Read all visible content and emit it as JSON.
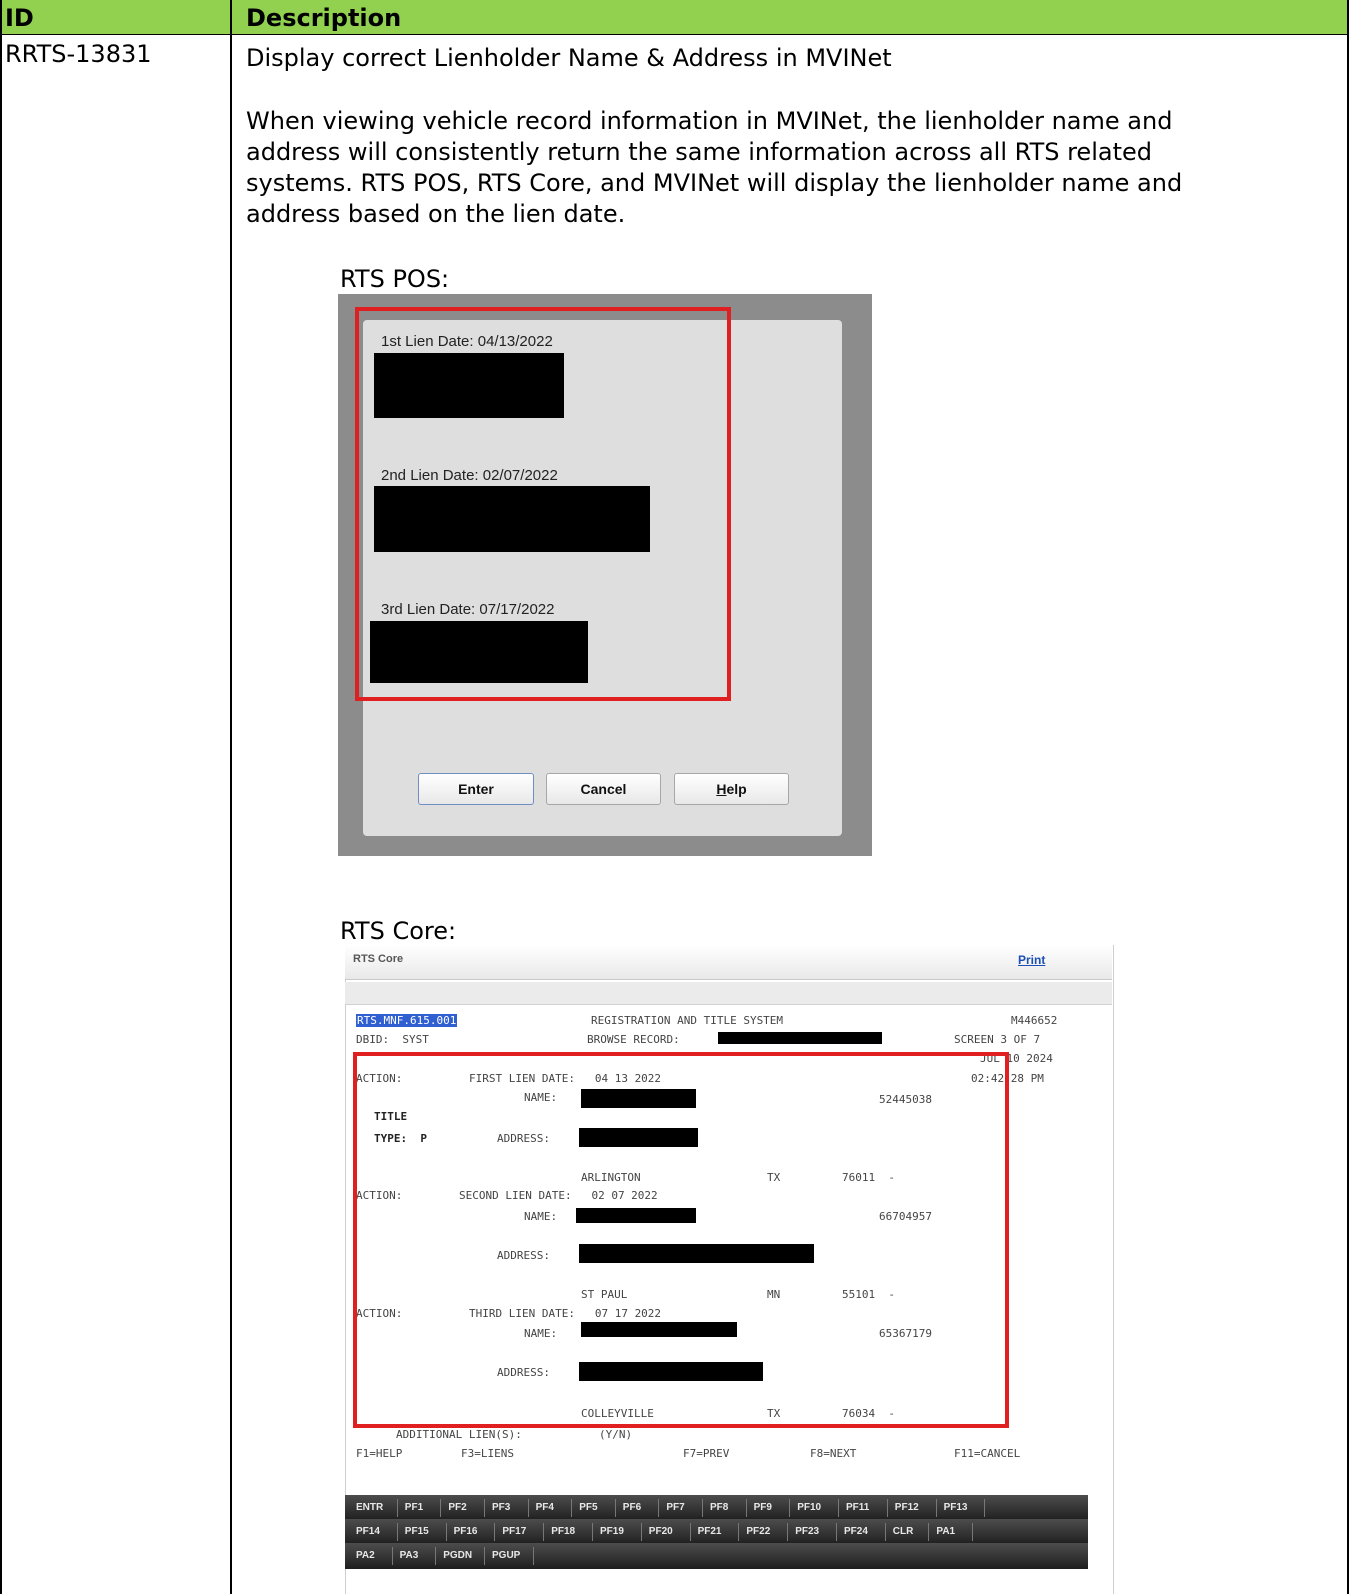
{
  "table": {
    "header_id": "ID",
    "header_description": "Description",
    "row_id": "RRTS-13831",
    "row_title": "Display correct Lienholder Name & Address in MVINet",
    "row_body": [
      "When viewing vehicle record information in MVINet, the lienholder name and",
      "address will consistently return the same information across all RTS related",
      "systems. RTS POS, RTS Core, and MVINet will display the lienholder name and",
      "address based on the lien date."
    ]
  },
  "pos": {
    "caption": "RTS POS:",
    "lien1": "1st Lien Date: 04/13/2022",
    "lien2": "2nd Lien Date: 02/07/2022",
    "lien3": "3rd Lien Date: 07/17/2022",
    "enter": "Enter",
    "cancel": "Cancel",
    "help_first": "H",
    "help_rest": "elp"
  },
  "core": {
    "caption": "RTS Core:",
    "title": "RTS Core",
    "print": "Print",
    "screen_id": "RTS.MNF.615.001",
    "system_title": "REGISTRATION AND TITLE SYSTEM",
    "code": "M446652",
    "dbid": "DBID:  SYST",
    "browse": "BROWSE RECORD:",
    "screen": "SCREEN 3 OF 7",
    "date": "JUL 10 2024",
    "time": "02:42:28 PM",
    "action": "ACTION:",
    "first_lien": "FIRST LIEN DATE:   04 13 2022",
    "second_lien": "SECOND LIEN DATE:   02 07 2022",
    "third_lien": "THIRD LIEN DATE:   07 17 2022",
    "name": "NAME:",
    "address": "ADDRESS:",
    "title_type1": "TITLE",
    "title_type2": "TYPE:  P",
    "num1": "52445038",
    "num2": "66704957",
    "num3": "65367179",
    "city1": "ARLINGTON",
    "state1": "TX",
    "zip1": "76011  -",
    "city2": "ST PAUL",
    "state2": "MN",
    "zip2": "55101  -",
    "city3": "COLLEYVILLE",
    "state3": "TX",
    "zip3": "76034  -",
    "additional": "ADDITIONAL LIEN(S):",
    "yn": "(Y/N)",
    "f1": "F1=HELP",
    "f3": "F3=LIENS",
    "f7": "F7=PREV",
    "f8": "F8=NEXT",
    "f11": "F11=CANCEL",
    "pf_row1": [
      "ENTR",
      "PF1",
      "PF2",
      "PF3",
      "PF4",
      "PF5",
      "PF6",
      "PF7",
      "PF8",
      "PF9",
      "PF10",
      "PF11",
      "PF12",
      "PF13"
    ],
    "pf_row2": [
      "PF14",
      "PF15",
      "PF16",
      "PF17",
      "PF18",
      "PF19",
      "PF20",
      "PF21",
      "PF22",
      "PF23",
      "PF24",
      "CLR",
      "PA1"
    ],
    "pf_row3": [
      "PA2",
      "PA3",
      "PGDN",
      "PGUP"
    ]
  }
}
